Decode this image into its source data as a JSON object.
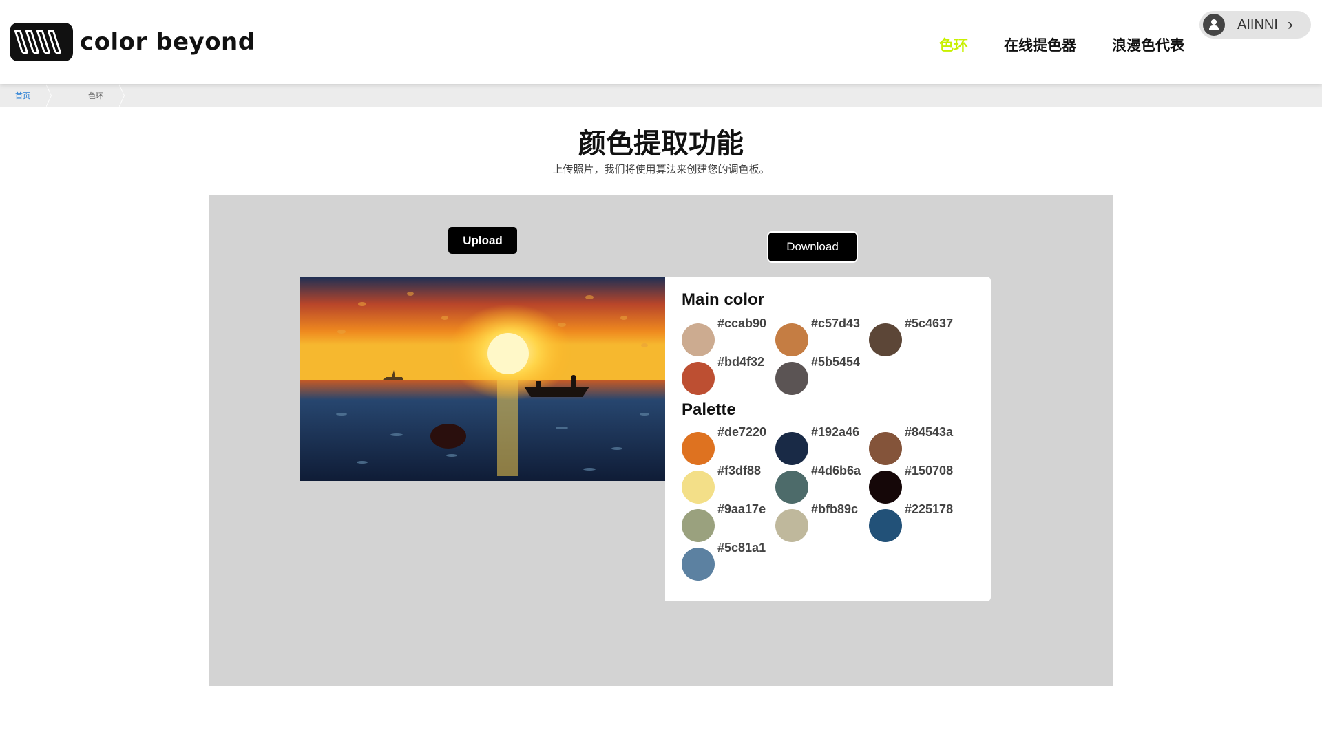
{
  "brand": {
    "name": "color beyond"
  },
  "nav": {
    "items": [
      {
        "label": "色环",
        "active": true
      },
      {
        "label": "在线提色器",
        "active": false
      },
      {
        "label": "浪漫色代表",
        "active": false
      }
    ],
    "active_color": "#c8f000"
  },
  "user": {
    "name": "AIINNI",
    "avatar_icon": "user-avatar-icon",
    "chevron_icon": "chevron-right-icon"
  },
  "breadcrumb": {
    "home": "首页",
    "current": "色环"
  },
  "page": {
    "title": "颜色提取功能",
    "subtitle": "上传照片，我们将使用算法来创建您的调色板。"
  },
  "actions": {
    "upload_label": "Upload",
    "download_label": "Download"
  },
  "main_color": {
    "title": "Main color",
    "colors": [
      "#ccab90",
      "#c57d43",
      "#5c4637",
      "#bd4f32",
      "#5b5454"
    ]
  },
  "palette": {
    "title": "Palette",
    "colors": [
      "#de7220",
      "#192a46",
      "#84543a",
      "#f3df88",
      "#4d6b6a",
      "#150708",
      "#9aa17e",
      "#bfb89c",
      "#225178",
      "#5c81a1"
    ]
  }
}
